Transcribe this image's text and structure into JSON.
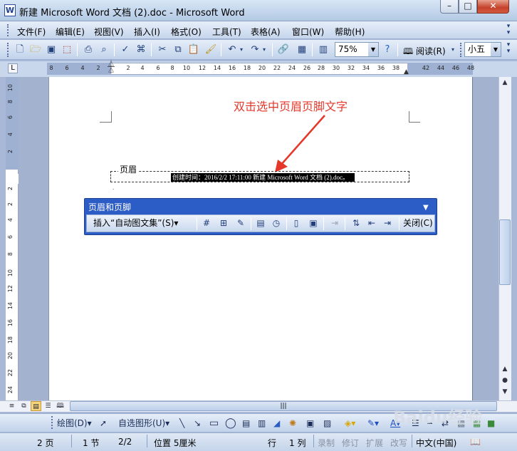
{
  "window": {
    "title": "新建 Microsoft Word 文档 (2).doc - Microsoft Word",
    "app_icon_letter": "W",
    "min_glyph": "–",
    "max_glyph": "□",
    "close_glyph": "✕"
  },
  "menubar": {
    "items": [
      "文件(F)",
      "编辑(E)",
      "视图(V)",
      "插入(I)",
      "格式(O)",
      "工具(T)",
      "表格(A)",
      "窗口(W)",
      "帮助(H)"
    ]
  },
  "toolbar": {
    "zoom": "75%",
    "read_label": "阅读(R)",
    "font_size": "小五"
  },
  "ruler": {
    "corner_glyph": "L",
    "h_ticks": [
      "8",
      "6",
      "4",
      "2",
      "2",
      "4",
      "6",
      "8",
      "10",
      "12",
      "14",
      "16",
      "18",
      "20",
      "22",
      "24",
      "26",
      "28",
      "30",
      "32",
      "34",
      "36",
      "38",
      "42",
      "44",
      "46",
      "48"
    ],
    "v_ticks": [
      "10",
      "8",
      "6",
      "4",
      "2",
      "2",
      "2",
      "4",
      "6",
      "8",
      "10",
      "12",
      "14",
      "16",
      "18",
      "20",
      "22",
      "24",
      "26"
    ]
  },
  "document": {
    "header_label": "页眉",
    "header_field_text": "创建时间：2016/2/2 17:11:00 新建 Microsoft Word 文档 (2).doc。",
    "annotation": "双击选中页眉页脚文字"
  },
  "hf_toolbar": {
    "title": "页眉和页脚",
    "insert_autotext": "插入“自动图文集”(S)▾",
    "close_label": "关闭(C)"
  },
  "drawbar": {
    "draw_label": "绘图(D)▾",
    "autoshape_label": "自选图形(U)▾"
  },
  "statusbar": {
    "page": "2 页",
    "section": "1 节",
    "page_of": "2/2",
    "position": "位置 5厘米",
    "line": "行",
    "column": "1 列",
    "rec": "录制",
    "trk": "修订",
    "ext": "扩展",
    "ovr": "改写",
    "language": "中文(中国)"
  },
  "watermark": "Baidu经验"
}
